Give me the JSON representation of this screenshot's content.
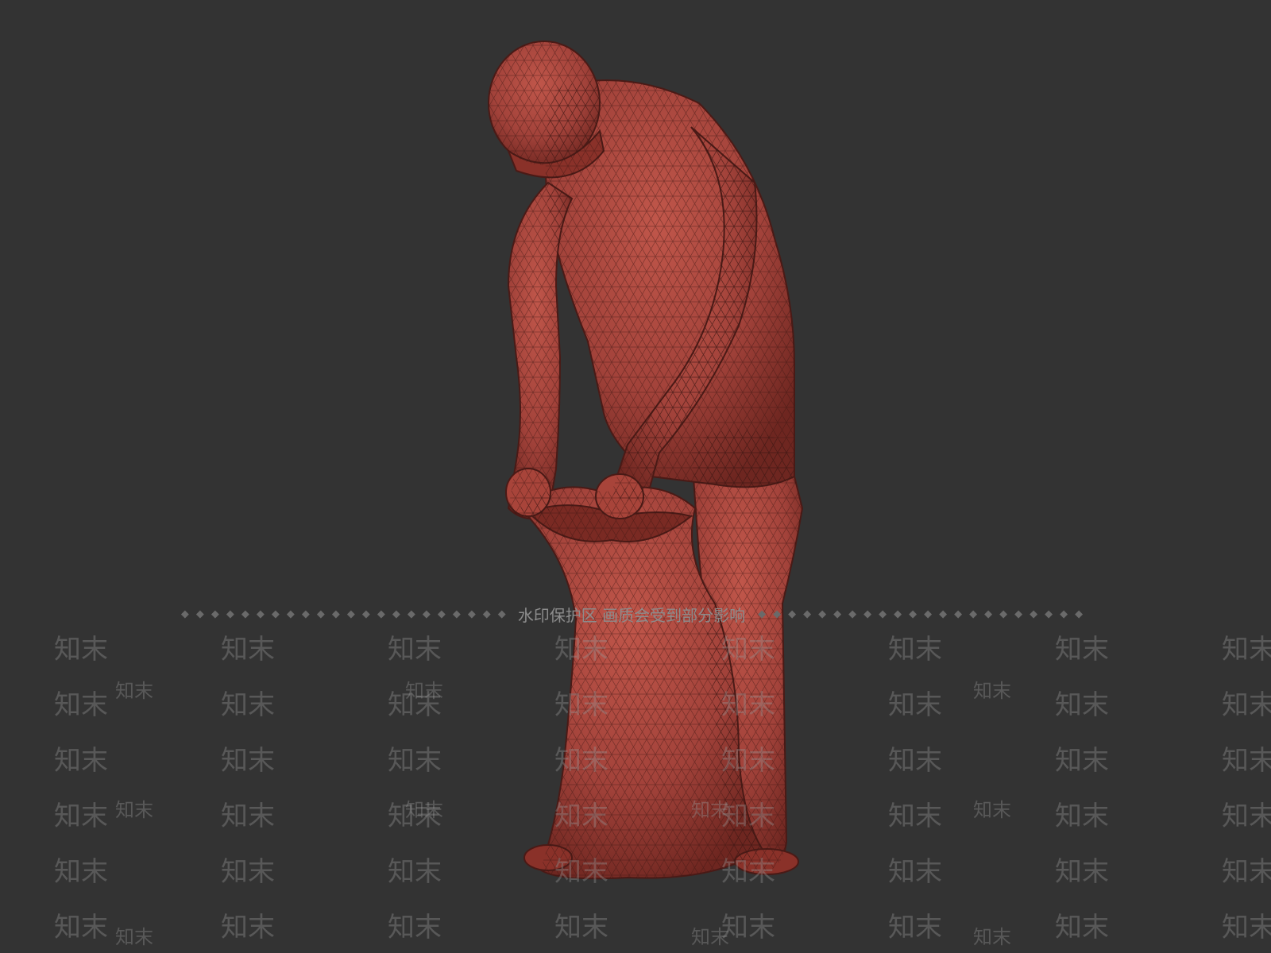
{
  "viewport": {
    "background": "#333333",
    "model_color": "#a8443a",
    "wire_color": "#3a1512"
  },
  "model": {
    "name": "man-holding-sack-icon"
  },
  "watermark": {
    "banner_text": "水印保护区   画质会受到部分影响",
    "dots": "◆◆◆◆◆◆◆◆◆◆◆◆◆◆◆◆◆◆◆◆◆◆",
    "tile_text": "知末"
  }
}
